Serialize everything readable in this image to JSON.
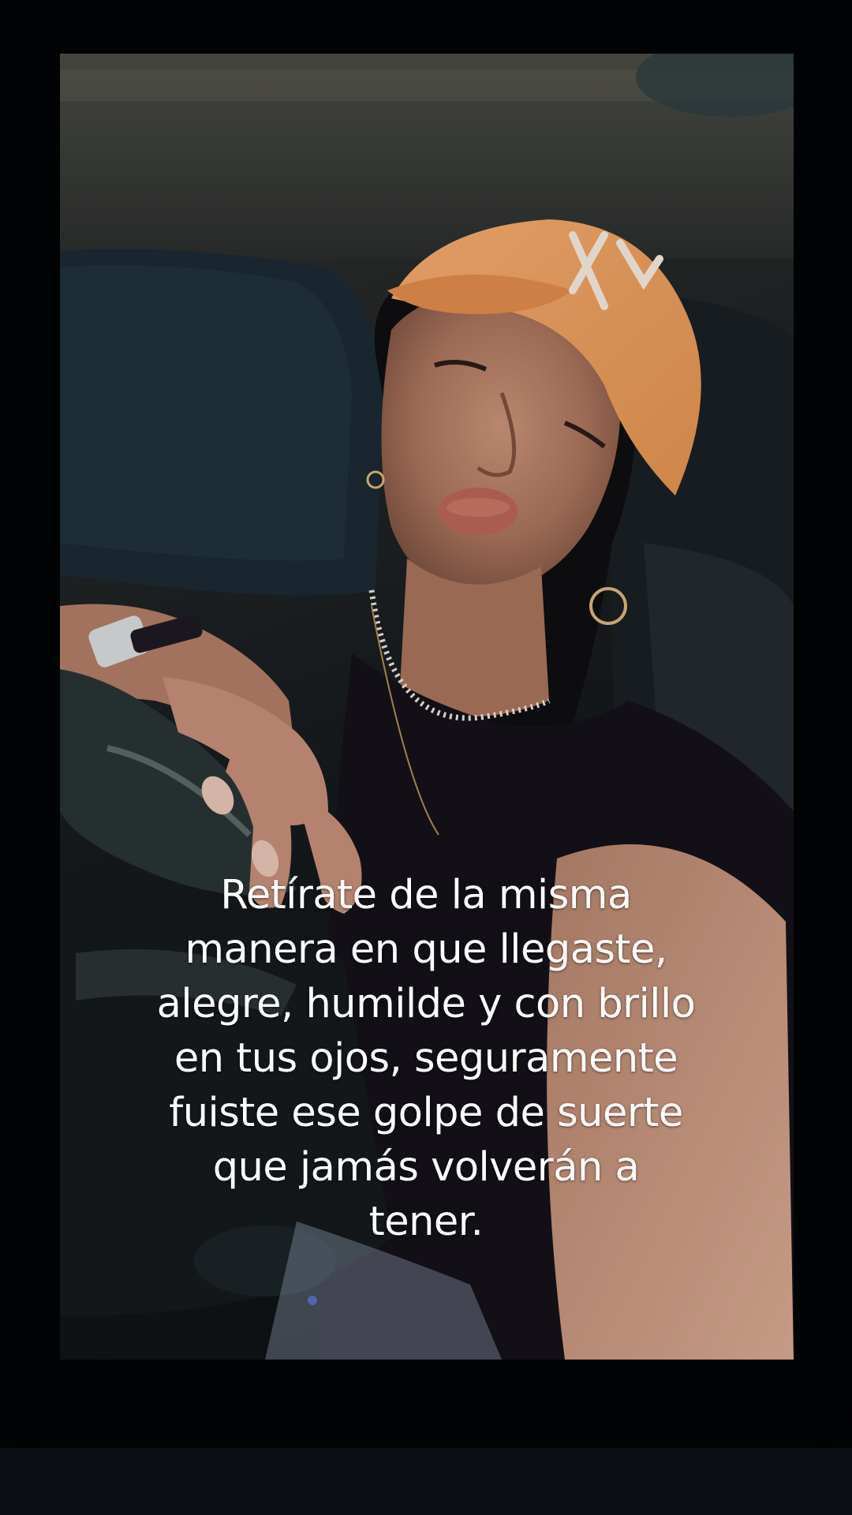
{
  "story": {
    "caption": "Retírate de la misma\nmanera en que llegaste,\nalegre, humilde y con brillo\nen tus ojos, seguramente\nfuiste ese golpe de suerte\nque jamás volverán a\ntener."
  },
  "colors": {
    "background": "#020305",
    "bottom_strip": "#0c1016",
    "caption_text": "#ffffff",
    "cap": "#f1a266"
  }
}
